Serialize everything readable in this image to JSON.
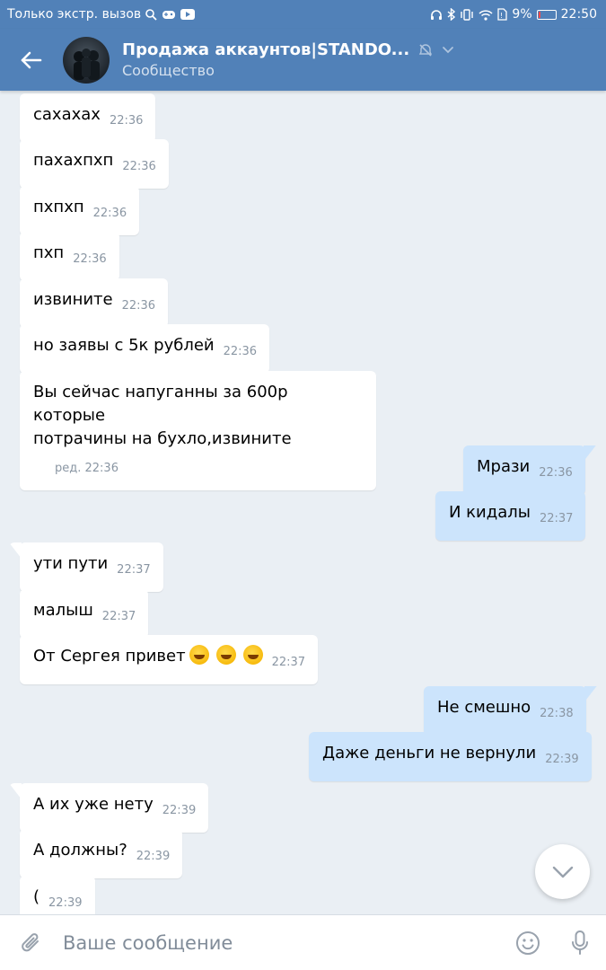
{
  "status_bar": {
    "carrier": "Только экстр. вызов",
    "battery": "9%",
    "time": "22:50"
  },
  "header": {
    "title": "Продажа аккаунтов|STANDO...",
    "subtitle": "Сообщество"
  },
  "messages": [
    {
      "dir": "in",
      "text": "сахахах",
      "time": "22:36"
    },
    {
      "dir": "in",
      "text": "пахахпхп",
      "time": "22:36"
    },
    {
      "dir": "in",
      "text": "пхпхп",
      "time": "22:36"
    },
    {
      "dir": "in",
      "text": "пхп",
      "time": "22:36"
    },
    {
      "dir": "in",
      "text": "извините",
      "time": "22:36"
    },
    {
      "dir": "in",
      "text": "но заявы с 5к рублей",
      "time": "22:36"
    },
    {
      "dir": "in",
      "text_line1": "Вы сейчас напуганны за 600р которые",
      "text_line2": "потрачины на бухло,извините",
      "time": "ред. 22:36"
    },
    {
      "dir": "out",
      "text": "Мрази",
      "time": "22:36"
    },
    {
      "dir": "out",
      "text": "И кидалы",
      "time": "22:37"
    },
    {
      "dir": "in",
      "text": "ути пути",
      "time": "22:37"
    },
    {
      "dir": "in",
      "text": "малыш",
      "time": "22:37"
    },
    {
      "dir": "in",
      "text": "От Сергея привет",
      "time": "22:37"
    },
    {
      "dir": "out",
      "text": "Не смешно",
      "time": "22:38"
    },
    {
      "dir": "out",
      "text": "Даже деньги не вернули",
      "time": "22:39"
    },
    {
      "dir": "in",
      "text": "А их уже нету",
      "time": "22:39"
    },
    {
      "dir": "in",
      "text": "А должны?",
      "time": "22:39"
    },
    {
      "dir": "in",
      "text": "(",
      "time": "22:39"
    }
  ],
  "composer": {
    "placeholder": "Ваше сообщение"
  },
  "icons": {
    "back": "arrow-left-icon",
    "mute": "muted-icon",
    "chevron": "chevron-down-icon",
    "attach": "paperclip-icon",
    "emoji": "smiley-icon",
    "mic": "microphone-icon",
    "scroll": "chevron-down-icon"
  },
  "colors": {
    "header": "#5181b8",
    "background": "#eaeff4",
    "incoming": "#ffffff",
    "outgoing": "#cce4fc"
  }
}
